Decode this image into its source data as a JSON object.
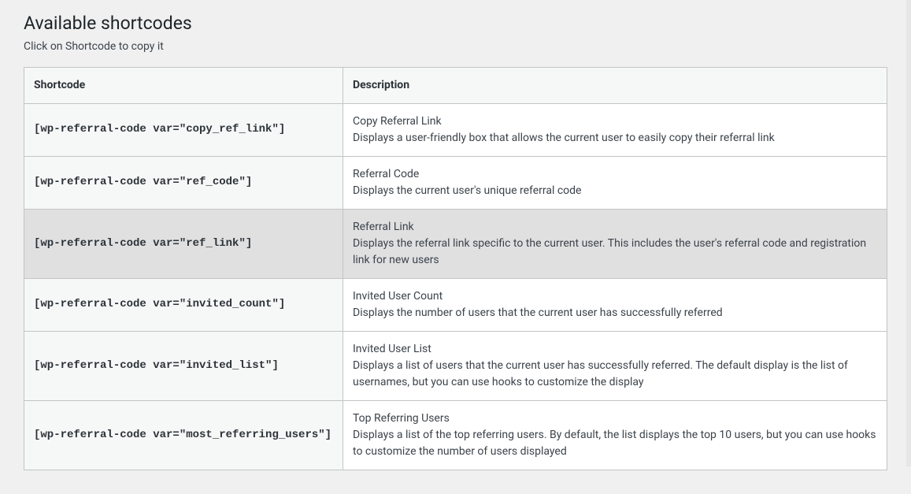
{
  "page": {
    "title": "Available shortcodes",
    "subtitle": "Click on Shortcode to copy it"
  },
  "table": {
    "headers": {
      "shortcode": "Shortcode",
      "description": "Description"
    },
    "rows": [
      {
        "code": "[wp-referral-code var=\"copy_ref_link\"]",
        "title": "Copy Referral Link",
        "text": "Displays a user-friendly box that allows the current user to easily copy their referral link",
        "highlight": false
      },
      {
        "code": "[wp-referral-code var=\"ref_code\"]",
        "title": "Referral Code",
        "text": "Displays the current user's unique referral code",
        "highlight": false
      },
      {
        "code": "[wp-referral-code var=\"ref_link\"]",
        "title": "Referral Link",
        "text": "Displays the referral link specific to the current user. This includes the user's referral code and registration link for new users",
        "highlight": true
      },
      {
        "code": "[wp-referral-code var=\"invited_count\"]",
        "title": "Invited User Count",
        "text": "Displays the number of users that the current user has successfully referred",
        "highlight": false
      },
      {
        "code": "[wp-referral-code var=\"invited_list\"]",
        "title": "Invited User List",
        "text": "Displays a list of users that the current user has successfully referred. The default display is the list of usernames, but you can use hooks to customize the display",
        "highlight": false
      },
      {
        "code": "[wp-referral-code var=\"most_referring_users\"]",
        "title": "Top Referring Users",
        "text": "Displays a list of the top referring users. By default, the list displays the top 10 users, but you can use hooks to customize the number of users displayed",
        "highlight": false
      }
    ]
  }
}
